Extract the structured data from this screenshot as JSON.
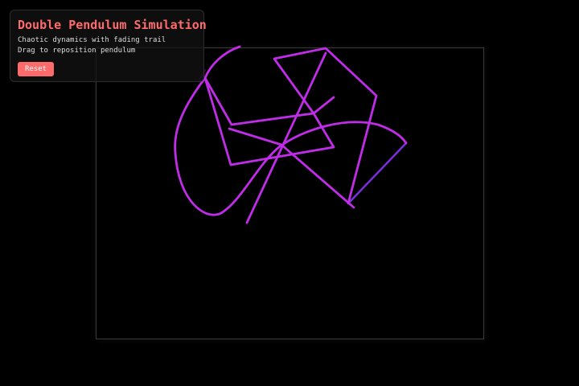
{
  "panel": {
    "title": "Double Pendulum Simulation",
    "description_line1": "Chaotic dynamics with fading trail",
    "description_line2": "Drag to reposition pendulum",
    "reset_label": "Reset"
  },
  "colors": {
    "background": "#000000",
    "accent": "#ff6b6b",
    "trail": "#c02ce8",
    "trail_faded": "#8a2be2",
    "canvas_border": "#3a3a3a",
    "text": "#dddddd"
  }
}
